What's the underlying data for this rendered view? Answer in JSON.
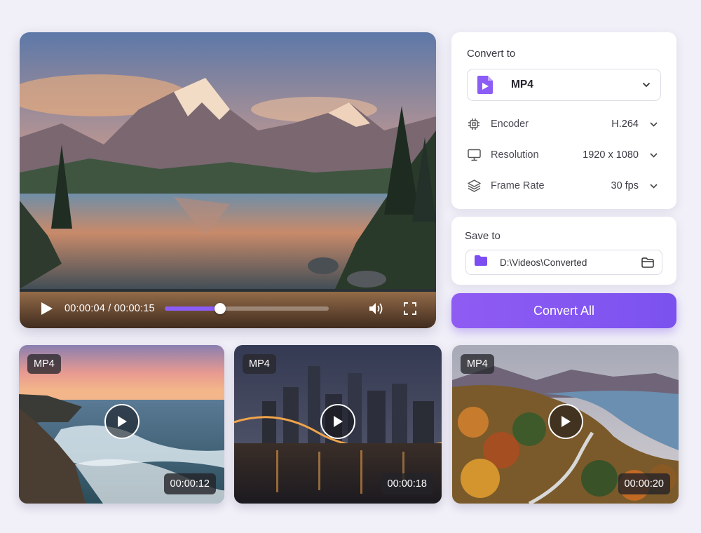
{
  "player": {
    "time_current": "00:00:04",
    "time_total": "00:00:15",
    "progress": 0.34
  },
  "convert": {
    "title": "Convert to",
    "format": "MP4",
    "options": [
      {
        "icon": "chip-icon",
        "label": "Encoder",
        "value": "H.264"
      },
      {
        "icon": "monitor-icon",
        "label": "Resolution",
        "value": "1920 x 1080"
      },
      {
        "icon": "layers-icon",
        "label": "Frame Rate",
        "value": "30 fps"
      }
    ]
  },
  "save": {
    "title": "Save to",
    "path": "D:\\Videos\\Converted"
  },
  "convert_button": "Convert All",
  "thumbnails": [
    {
      "format": "MP4",
      "duration": "00:00:12",
      "subject": "ocean-sunset"
    },
    {
      "format": "MP4",
      "duration": "00:00:18",
      "subject": "city-night"
    },
    {
      "format": "MP4",
      "duration": "00:00:20",
      "subject": "autumn-forest"
    }
  ],
  "colors": {
    "accent": "#8b5cf6",
    "background": "#f1f0f8"
  }
}
